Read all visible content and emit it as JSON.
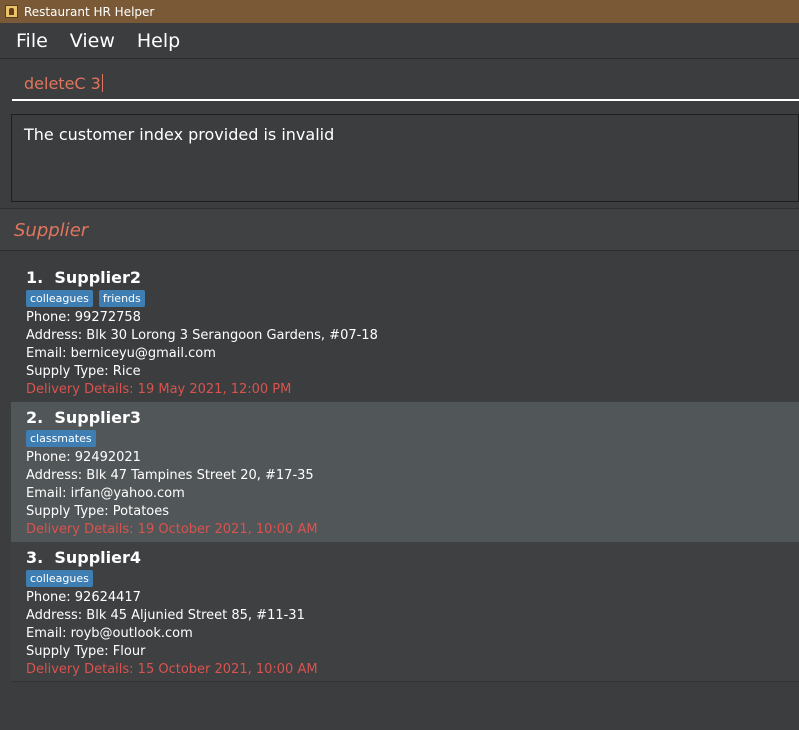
{
  "window": {
    "title": "Restaurant HR Helper"
  },
  "menu": {
    "file": "File",
    "view": "View",
    "help": "Help"
  },
  "command": {
    "value": "deleteC 3"
  },
  "result": {
    "message": "The customer index provided is invalid"
  },
  "section": {
    "title": "Supplier"
  },
  "suppliers": [
    {
      "index": "1.",
      "name": "Supplier2",
      "tags": [
        "colleagues",
        "friends"
      ],
      "phone": "Phone: 99272758",
      "address": "Address: Blk 30 Lorong 3 Serangoon Gardens, #07-18",
      "email": "Email: berniceyu@gmail.com",
      "supply": "Supply Type: Rice",
      "delivery": "Delivery Details: 19 May 2021, 12:00 PM"
    },
    {
      "index": "2.",
      "name": "Supplier3",
      "tags": [
        "classmates"
      ],
      "phone": "Phone: 92492021",
      "address": "Address: Blk 47 Tampines Street 20, #17-35",
      "email": "Email: irfan@yahoo.com",
      "supply": "Supply Type: Potatoes",
      "delivery": "Delivery Details: 19 October 2021, 10:00 AM"
    },
    {
      "index": "3.",
      "name": "Supplier4",
      "tags": [
        "colleagues"
      ],
      "phone": "Phone: 92624417",
      "address": "Address: Blk 45 Aljunied Street 85, #11-31",
      "email": "Email: royb@outlook.com",
      "supply": "Supply Type: Flour",
      "delivery": "Delivery Details: 15 October 2021, 10:00 AM"
    }
  ],
  "colors": {
    "titlebar": "#7a5a36",
    "background": "#3b3d3f",
    "accent": "#e0755e",
    "tag": "#3e7eb3",
    "delivery": "#d9534f",
    "selected": "#515658"
  }
}
